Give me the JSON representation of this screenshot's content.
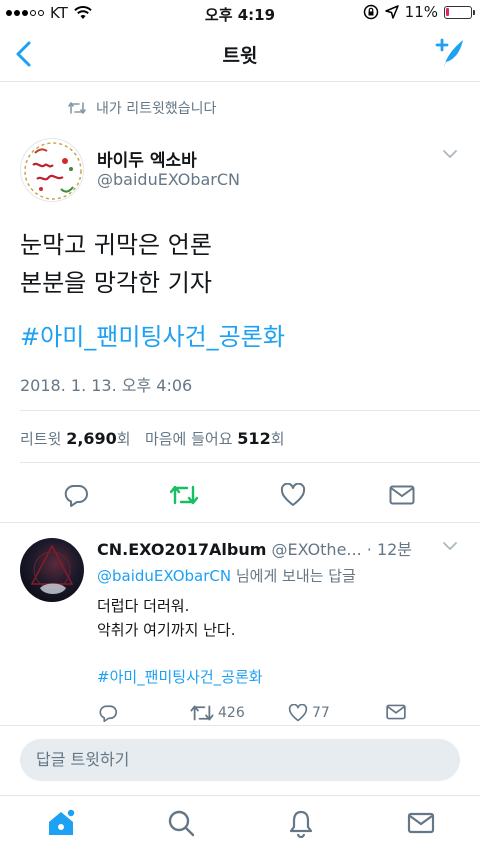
{
  "status_bar": {
    "carrier": "KT",
    "time": "오후 4:19",
    "battery_percent": "11%",
    "battery_level": 0.11
  },
  "nav": {
    "title": "트윗"
  },
  "retweet_context": "내가 리트윗했습니다",
  "main_tweet": {
    "display_name": "바이두 엑소바",
    "handle": "@baiduEXObarCN",
    "text_line1": "눈막고 귀막은 언론",
    "text_line2": "본분을 망각한 기자",
    "hashtag": "#아미_팬미팅사건_공론화",
    "timestamp": "2018. 1. 13. 오후 4:06",
    "retweet_label": "리트윗",
    "retweet_count": "2,690",
    "unit": "회",
    "like_label": "마음에 들어요",
    "like_count": "512"
  },
  "reply": {
    "display_name": "CN.EXO2017Album",
    "handle": "@EXOthe...",
    "time": "· 12분",
    "reply_to_mention": "@baiduEXObarCN",
    "reply_to_suffix": " 님에게 보내는 답글",
    "line1": "더럽다 더러워.",
    "line2": "악취가 여기까지 난다.",
    "hashtag": "#아미_팬미팅사건_공론화",
    "retweet_count": "426",
    "like_count": "77"
  },
  "reply_bar": {
    "placeholder": "답글 트윗하기"
  },
  "colors": {
    "accent": "#1da1f2",
    "retweet_green": "#17bf63",
    "muted": "#657786",
    "battery_low": "#e0245e"
  }
}
